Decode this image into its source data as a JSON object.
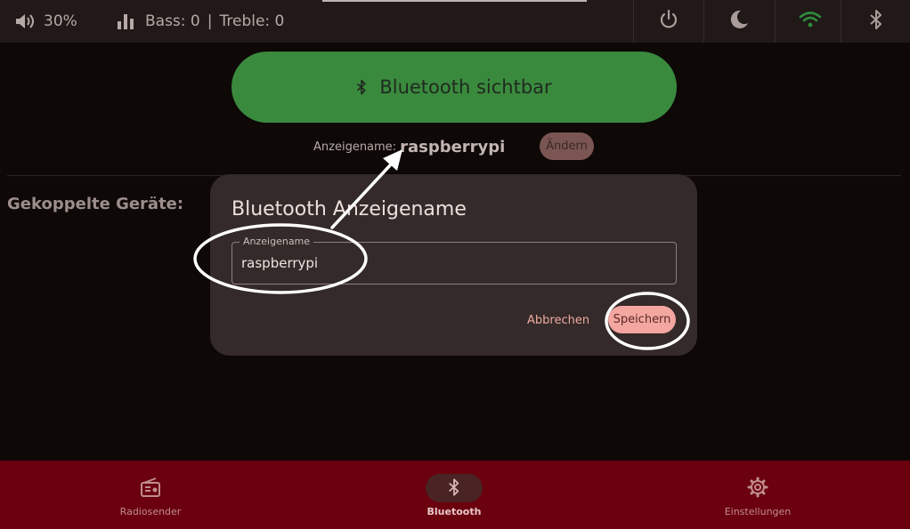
{
  "status_bar": {
    "volume": "30%",
    "bass": "Bass: 0",
    "separator": "|",
    "treble": "Treble: 0",
    "icons": [
      "volume-icon",
      "equalizer-icon",
      "power-icon",
      "moon-icon",
      "wifi-icon",
      "bluetooth-icon"
    ],
    "wifi_color": "#2e8b3c"
  },
  "bluetooth_page": {
    "visible_button_label": "Bluetooth sichtbar",
    "visible_button_color": "#3a8a3e",
    "display_name_label": "Anzeigename:",
    "display_name_value": "raspberrypi",
    "change_button_label": "Ändern",
    "paired_devices_title": "Gekoppelte Geräte:"
  },
  "dialog": {
    "title": "Bluetooth Anzeigename",
    "field_label": "Anzeigename",
    "field_value": "raspberrypi",
    "cancel_label": "Abbrechen",
    "save_label": "Speichern",
    "save_color": "#f4a6a0"
  },
  "bottom_nav": {
    "background": "#6b000f",
    "items": [
      {
        "label": "Radiosender",
        "icon": "radio-icon",
        "active": false
      },
      {
        "label": "Bluetooth",
        "icon": "bluetooth-icon",
        "active": true
      },
      {
        "label": "Einstellungen",
        "icon": "gear-icon",
        "active": false
      }
    ]
  }
}
